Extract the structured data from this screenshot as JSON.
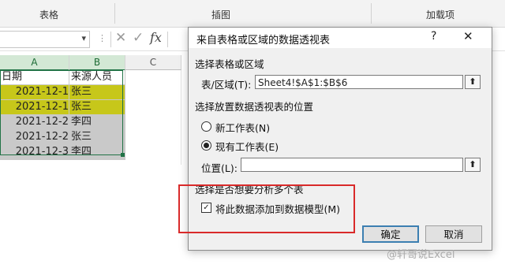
{
  "ribbon": {
    "groups": [
      "表格",
      "插图",
      "加载项"
    ]
  },
  "formula_bar": {
    "name_box_value": "",
    "dots": "⋮",
    "cancel_icon": "✕",
    "enter_icon": "✓",
    "fx_label": "fx",
    "formula_value": ""
  },
  "sheet": {
    "columns": [
      "A",
      "B",
      "C"
    ],
    "rows": [
      {
        "a": "日期",
        "b": "来源人员",
        "style": "header"
      },
      {
        "a": "2021-12-1",
        "b": "张三",
        "style": "yellow"
      },
      {
        "a": "2021-12-1",
        "b": "张三",
        "style": "yellow"
      },
      {
        "a": "2021-12-2",
        "b": "李四",
        "style": "gray"
      },
      {
        "a": "2021-12-2",
        "b": "张三",
        "style": "gray"
      },
      {
        "a": "2021-12-3",
        "b": "李四",
        "style": "gray"
      }
    ]
  },
  "dialog": {
    "title": "来自表格或区域的数据透视表",
    "help": "?",
    "close": "✕",
    "section1": "选择表格或区域",
    "range_label": "表/区域(T):",
    "range_value": "Sheet4!$A$1:$B$6",
    "section2": "选择放置数据透视表的位置",
    "radio_new": "新工作表(N)",
    "radio_existing": "现有工作表(E)",
    "location_label": "位置(L):",
    "location_value": "",
    "section3": "选择是否想要分析多个表",
    "checkbox_label": "将此数据添加到数据模型(M)",
    "checkbox_checked": true,
    "ok": "确定",
    "cancel": "取消",
    "collapse_icon": "⬆"
  },
  "watermark": "@轩哥说Excel",
  "colors": {
    "yellow": "#c7c71a",
    "gray": "#c9c9c9",
    "accent": "#217346",
    "highlight_box": "#d92a2a"
  }
}
